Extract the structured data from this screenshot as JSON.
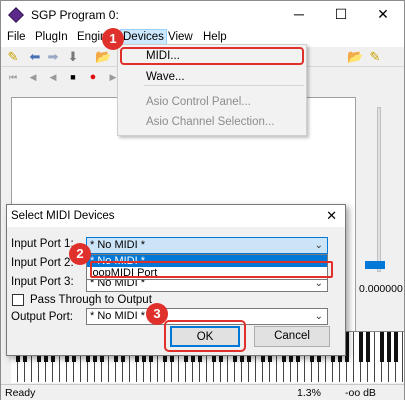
{
  "window": {
    "title": "SGP Program 0:",
    "minimize": "─",
    "maximize": "☐",
    "close": "✕"
  },
  "menubar": {
    "items": [
      "File",
      "PlugIn",
      "Engine",
      "Devices",
      "View",
      "Help"
    ]
  },
  "devices_menu": {
    "items": [
      "MIDI...",
      "Wave...",
      "Asio Control Panel...",
      "Asio Channel Selection..."
    ]
  },
  "dialog": {
    "title": "Select MIDI Devices",
    "close": "✕",
    "input_port_1_label": "Input Port 1:",
    "input_port_2_label": "Input Port 2:",
    "input_port_3_label": "Input Port 3:",
    "input_port_1_value": "* No MIDI *",
    "input_port_3_value": "* No MIDI *",
    "list_options": [
      "* No MIDI *",
      "loopMIDI Port"
    ],
    "pass_through_label": "Pass Through to Output",
    "output_port_label": "Output Port:",
    "output_port_value": "* No MIDI *",
    "ok_label": "OK",
    "cancel_label": "Cancel"
  },
  "level": {
    "value": "0.000000"
  },
  "status": {
    "ready": "Ready",
    "percent": "1.3%",
    "db": "-oo dB"
  },
  "steps": [
    "1",
    "2",
    "3"
  ],
  "colors": {
    "highlight": "#e0302b",
    "accent": "#0078d7"
  }
}
